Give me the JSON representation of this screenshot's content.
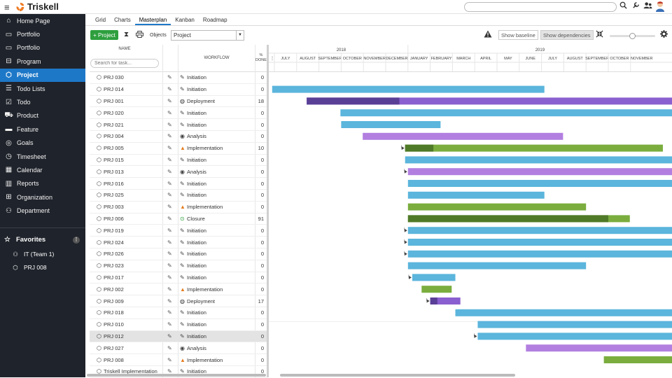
{
  "brand": {
    "name": "Triskell"
  },
  "topbar": {
    "icons": [
      "search-icon",
      "wrench-icon",
      "users-icon",
      "avatar"
    ]
  },
  "sidebar": {
    "items": [
      {
        "label": "Home Page",
        "icon": "home-icon"
      },
      {
        "label": "Portfolio",
        "icon": "folder-icon"
      },
      {
        "label": "Portfolio",
        "icon": "briefcase-icon"
      },
      {
        "label": "Program",
        "icon": "program-icon"
      },
      {
        "label": "Project",
        "icon": "cube-icon",
        "active": true
      },
      {
        "label": "Todo Lists",
        "icon": "list-icon"
      },
      {
        "label": "Todo",
        "icon": "checkbox-icon"
      },
      {
        "label": "Product",
        "icon": "product-icon"
      },
      {
        "label": "Feature",
        "icon": "feature-icon"
      },
      {
        "label": "Goals",
        "icon": "goals-icon"
      },
      {
        "label": "Timesheet",
        "icon": "clock-icon"
      },
      {
        "label": "Calendar",
        "icon": "calendar-icon"
      },
      {
        "label": "Reports",
        "icon": "chart-icon"
      },
      {
        "label": "Organization",
        "icon": "org-icon"
      },
      {
        "label": "Department",
        "icon": "department-icon"
      }
    ],
    "favorites_label": "Favorites",
    "favorites": [
      {
        "label": "IT (Team 1)",
        "icon": "team-icon"
      },
      {
        "label": "PRJ 008",
        "icon": "cube-icon"
      }
    ]
  },
  "tabs": [
    "Grid",
    "Charts",
    "Masterplan",
    "Kanban",
    "Roadmap"
  ],
  "active_tab": "Masterplan",
  "toolbar": {
    "add_label": "+ Project",
    "objects_label": "Objects",
    "objects_value": "Project",
    "show_baseline": "Show baseline",
    "show_dependencies": "Show dependencies",
    "zoom_fraction": 0.5
  },
  "grid": {
    "col_name": "NAME",
    "col_workflow": "WORKFLOW",
    "col_done_1": "%",
    "col_done_2": "DONE",
    "search_placeholder": "Search for task...",
    "rows": [
      {
        "name": "PRJ 030",
        "workflow": "Initiation",
        "wf_icon": "pencil-icon",
        "done": "0"
      },
      {
        "name": "PRJ 014",
        "workflow": "Initiation",
        "wf_icon": "pencil-icon",
        "done": "0"
      },
      {
        "name": "PRJ 001",
        "workflow": "Deployment",
        "wf_icon": "globe-icon",
        "done": "18"
      },
      {
        "name": "PRJ 020",
        "workflow": "Initiation",
        "wf_icon": "pencil-icon",
        "done": "0"
      },
      {
        "name": "PRJ 021",
        "workflow": "Initiation",
        "wf_icon": "pencil-icon",
        "done": "0"
      },
      {
        "name": "PRJ 004",
        "workflow": "Analysis",
        "wf_icon": "eye-icon",
        "done": "0"
      },
      {
        "name": "PRJ 005",
        "workflow": "Implementation",
        "wf_icon": "cone-icon",
        "done": "10"
      },
      {
        "name": "PRJ 015",
        "workflow": "Initiation",
        "wf_icon": "pencil-icon",
        "done": "0"
      },
      {
        "name": "PRJ 013",
        "workflow": "Analysis",
        "wf_icon": "eye-icon",
        "done": "0"
      },
      {
        "name": "PRJ 016",
        "workflow": "Initiation",
        "wf_icon": "pencil-icon",
        "done": "0"
      },
      {
        "name": "PRJ 025",
        "workflow": "Initiation",
        "wf_icon": "pencil-icon",
        "done": "0"
      },
      {
        "name": "PRJ 003",
        "workflow": "Implementation",
        "wf_icon": "cone-icon",
        "done": "0"
      },
      {
        "name": "PRJ 006",
        "workflow": "Closure",
        "wf_icon": "magnifier-icon",
        "done": "91"
      },
      {
        "name": "PRJ 019",
        "workflow": "Initiation",
        "wf_icon": "pencil-icon",
        "done": "0"
      },
      {
        "name": "PRJ 024",
        "workflow": "Initiation",
        "wf_icon": "pencil-icon",
        "done": "0"
      },
      {
        "name": "PRJ 026",
        "workflow": "Initiation",
        "wf_icon": "pencil-icon",
        "done": "0"
      },
      {
        "name": "PRJ 023",
        "workflow": "Initiation",
        "wf_icon": "pencil-icon",
        "done": "0"
      },
      {
        "name": "PRJ 017",
        "workflow": "Initiation",
        "wf_icon": "pencil-icon",
        "done": "0"
      },
      {
        "name": "PRJ 002",
        "workflow": "Implementation",
        "wf_icon": "cone-icon",
        "done": "0"
      },
      {
        "name": "PRJ 009",
        "workflow": "Deployment",
        "wf_icon": "globe-icon",
        "done": "17"
      },
      {
        "name": "PRJ 018",
        "workflow": "Initiation",
        "wf_icon": "pencil-icon",
        "done": "0"
      },
      {
        "name": "PRJ 010",
        "workflow": "Initiation",
        "wf_icon": "pencil-icon",
        "done": "0"
      },
      {
        "name": "PRJ 012",
        "workflow": "Initiation",
        "wf_icon": "pencil-icon",
        "done": "0",
        "selected": true
      },
      {
        "name": "PRJ 027",
        "workflow": "Analysis",
        "wf_icon": "eye-icon",
        "done": "0"
      },
      {
        "name": "PRJ 008",
        "workflow": "Implementation",
        "wf_icon": "cone-icon",
        "done": "0"
      },
      {
        "name": "Triskell Implementation",
        "workflow": "Initiation",
        "wf_icon": "pencil-icon",
        "done": "0"
      }
    ]
  },
  "gantt": {
    "years": [
      {
        "label": "2018",
        "start": "2018-07"
      },
      {
        "label": "2019",
        "start": "2019-01"
      }
    ],
    "months": [
      "JULY",
      "AUGUST",
      "SEPTEMBER",
      "OCTOBER",
      "NOVEMBER",
      "DECEMBER",
      "JANUARY",
      "FEBRUARY",
      "MARCH",
      "APRIL",
      "MAY",
      "JUNE",
      "JULY",
      "AUGUST",
      "SEPTEMBER",
      "OCTOBER",
      "NOVEMBER"
    ],
    "colors": {
      "Initiation": "#5bb5dc",
      "Deployment": "#8a5fcf",
      "Deployment_done": "#5a3f96",
      "Analysis": "#b27fe0",
      "Implementation": "#7aad3e",
      "Implementation_done": "#4f7a28"
    },
    "bars": [
      {
        "row": 0,
        "start": null,
        "end": null,
        "phase": "Initiation"
      },
      {
        "row": 1,
        "start": "2018-06-28",
        "end": "2019-07-05",
        "phase": "Initiation"
      },
      {
        "row": 2,
        "start": "2018-08-15",
        "end": "2019-12-31",
        "phase": "Deployment",
        "done_end": "2018-12-20"
      },
      {
        "row": 3,
        "start": "2018-09-30",
        "end": "2019-12-31",
        "phase": "Initiation"
      },
      {
        "row": 4,
        "start": "2018-10-01",
        "end": "2019-02-14",
        "phase": "Initiation"
      },
      {
        "row": 5,
        "start": "2018-10-31",
        "end": "2019-07-31",
        "phase": "Analysis"
      },
      {
        "row": 6,
        "start": "2018-12-28",
        "end": "2019-12-15",
        "phase": "Implementation",
        "done_end": "2019-02-05"
      },
      {
        "row": 7,
        "start": "2018-12-28",
        "end": "2019-12-31",
        "phase": "Initiation"
      },
      {
        "row": 8,
        "start": "2019-01-01",
        "end": "2019-12-31",
        "phase": "Analysis"
      },
      {
        "row": 9,
        "start": "2019-01-01",
        "end": "2019-12-31",
        "phase": "Initiation"
      },
      {
        "row": 10,
        "start": "2019-01-01",
        "end": "2019-07-05",
        "phase": "Initiation"
      },
      {
        "row": 11,
        "start": "2019-01-01",
        "end": "2019-09-01",
        "phase": "Implementation"
      },
      {
        "row": 12,
        "start": "2019-01-01",
        "end": "2019-10-31",
        "phase": "Implementation",
        "done_end": "2019-10-01"
      },
      {
        "row": 13,
        "start": "2019-01-01",
        "end": "2019-12-31",
        "phase": "Initiation"
      },
      {
        "row": 14,
        "start": "2019-01-01",
        "end": "2019-12-31",
        "phase": "Initiation"
      },
      {
        "row": 15,
        "start": "2019-01-01",
        "end": "2019-12-31",
        "phase": "Initiation"
      },
      {
        "row": 16,
        "start": "2019-01-01",
        "end": "2019-09-01",
        "phase": "Initiation"
      },
      {
        "row": 17,
        "start": "2019-01-07",
        "end": "2019-03-05",
        "phase": "Initiation"
      },
      {
        "row": 18,
        "start": "2019-01-20",
        "end": "2019-02-28",
        "phase": "Implementation"
      },
      {
        "row": 19,
        "start": "2019-02-01",
        "end": "2019-03-12",
        "phase": "Deployment",
        "done_end": "2019-02-10"
      },
      {
        "row": 20,
        "start": "2019-03-05",
        "end": "2019-12-31",
        "phase": "Initiation"
      },
      {
        "row": 21,
        "start": "2019-04-05",
        "end": "2019-12-31",
        "phase": "Initiation"
      },
      {
        "row": 22,
        "start": "2019-04-05",
        "end": "2019-12-31",
        "phase": "Initiation"
      },
      {
        "row": 23,
        "start": "2019-06-10",
        "end": "2019-12-31",
        "phase": "Analysis"
      },
      {
        "row": 24,
        "start": "2019-09-25",
        "end": "2019-12-31",
        "phase": "Implementation"
      }
    ],
    "dep_rows": [
      6,
      8,
      13,
      14,
      15,
      17,
      19,
      22
    ]
  }
}
